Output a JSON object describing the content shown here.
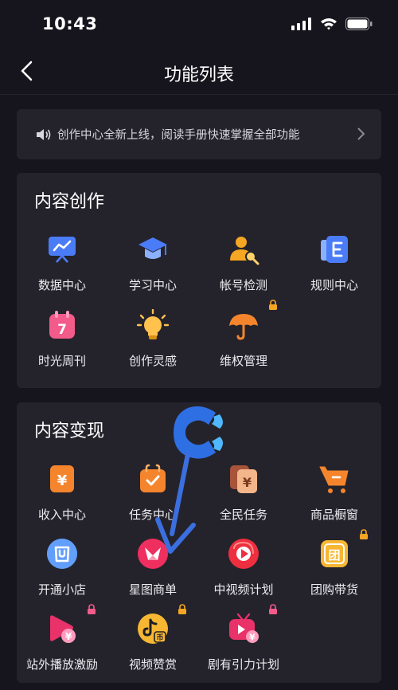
{
  "status_bar": {
    "time": "10:43"
  },
  "header": {
    "title": "功能列表"
  },
  "notice": {
    "text": "创作中心全新上线，阅读手册快速掌握全部功能"
  },
  "sections": [
    {
      "title": "内容创作",
      "items": [
        {
          "label": "数据中心",
          "icon": "data-board-icon"
        },
        {
          "label": "学习中心",
          "icon": "graduation-cap-icon"
        },
        {
          "label": "帐号检测",
          "icon": "user-search-icon"
        },
        {
          "label": "规则中心",
          "icon": "rulebook-icon"
        },
        {
          "label": "时光周刊",
          "icon": "calendar-7-icon"
        },
        {
          "label": "创作灵感",
          "icon": "lightbulb-icon"
        },
        {
          "label": "维权管理",
          "icon": "umbrella-icon"
        }
      ]
    },
    {
      "title": "内容变现",
      "items": [
        {
          "label": "收入中心",
          "icon": "yen-wallet-icon"
        },
        {
          "label": "任务中心",
          "icon": "task-bag-icon"
        },
        {
          "label": "全民任务",
          "icon": "yen-cards-icon"
        },
        {
          "label": "商品橱窗",
          "icon": "shopping-cart-icon"
        },
        {
          "label": "开通小店",
          "icon": "shop-bag-icon"
        },
        {
          "label": "星图商单",
          "icon": "star-chart-icon"
        },
        {
          "label": "中视频计划",
          "icon": "play-video-icon"
        },
        {
          "label": "团购带货",
          "icon": "group-buy-icon"
        },
        {
          "label": "站外播放激励",
          "icon": "play-yen-icon"
        },
        {
          "label": "视频赞赏",
          "icon": "tiktok-coin-icon"
        },
        {
          "label": "剧有引力计划",
          "icon": "tv-yen-icon"
        }
      ]
    }
  ],
  "watermark": {
    "letter": "C"
  },
  "colors": {
    "background": "#16151d",
    "card": "#24232c",
    "arrow": "#3b6fe0",
    "text": "#ffffff"
  }
}
